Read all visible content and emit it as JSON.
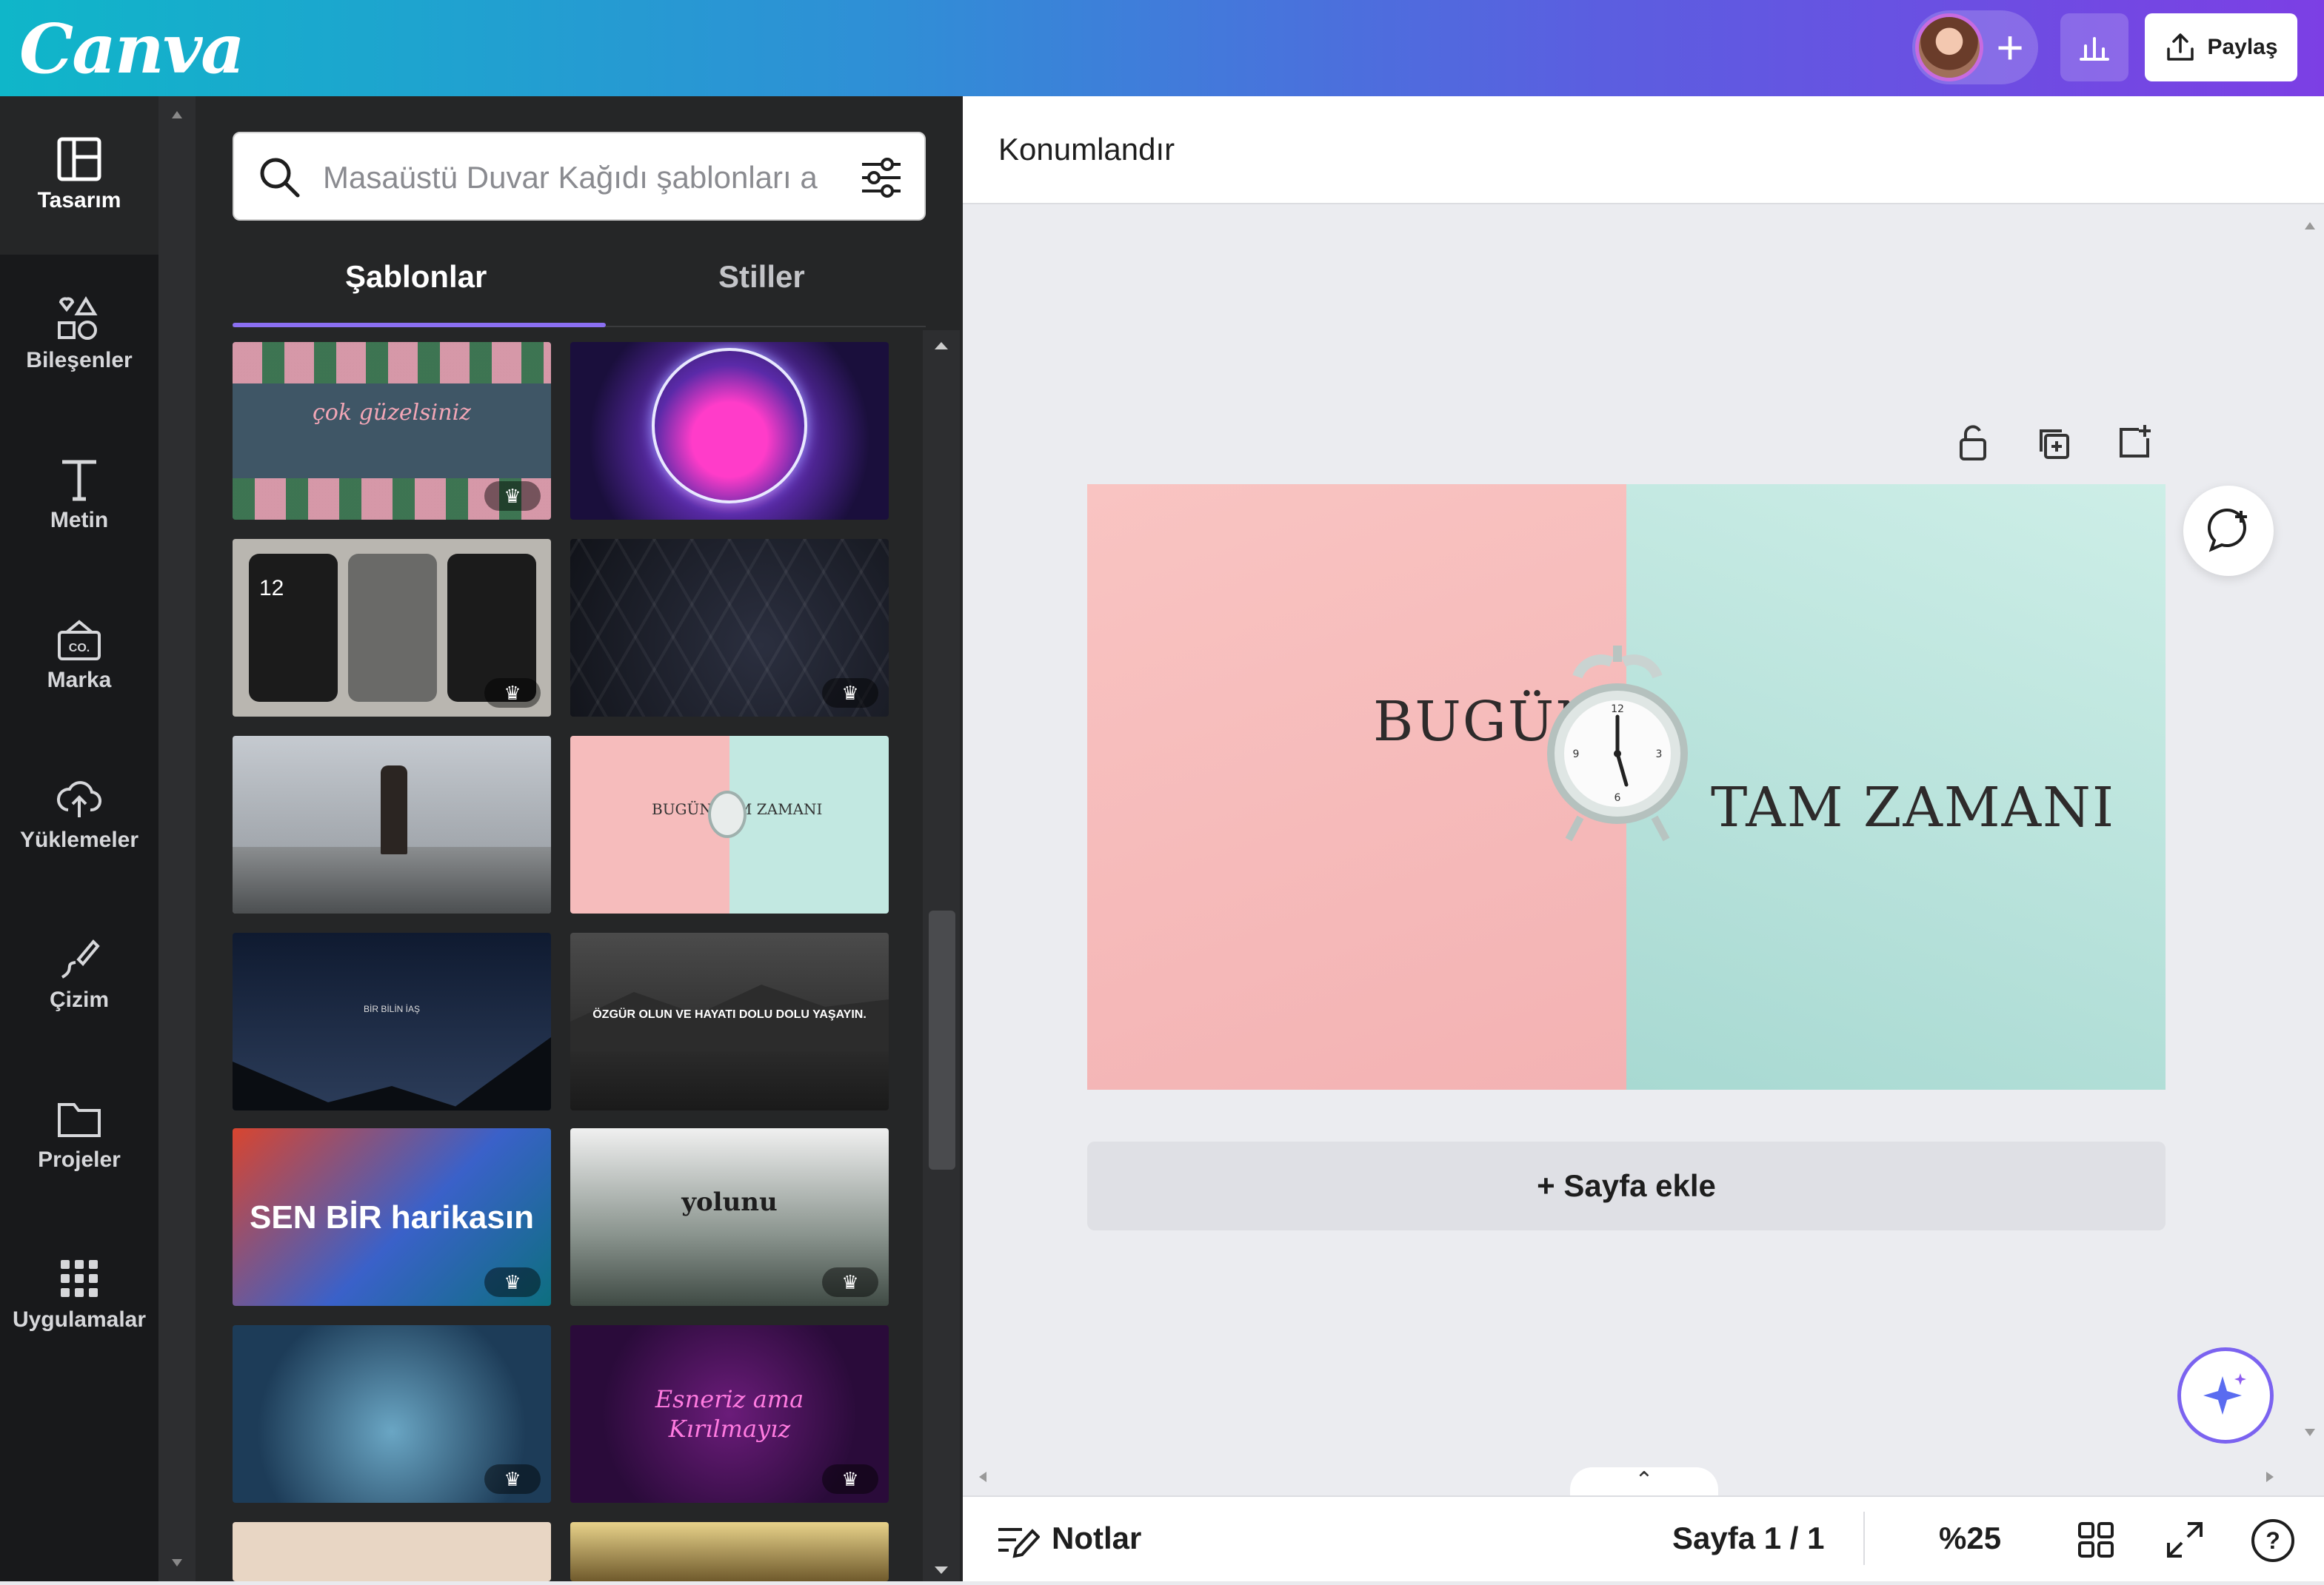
{
  "app": {
    "logo": "Canva"
  },
  "header": {
    "share_label": "Paylaş",
    "add_icon": "plus-icon",
    "analytics_icon": "analytics-icon",
    "share_icon": "upload-icon"
  },
  "sidebar": {
    "items": [
      {
        "label": "Tasarım",
        "icon": "layout-icon"
      },
      {
        "label": "Bileşenler",
        "icon": "shapes-icon"
      },
      {
        "label": "Metin",
        "icon": "text-icon"
      },
      {
        "label": "Marka",
        "icon": "brand-icon"
      },
      {
        "label": "Yüklemeler",
        "icon": "upload-cloud-icon"
      },
      {
        "label": "Çizim",
        "icon": "draw-icon"
      },
      {
        "label": "Projeler",
        "icon": "folder-icon"
      },
      {
        "label": "Uygulamalar",
        "icon": "apps-grid-icon"
      }
    ]
  },
  "panel": {
    "search_placeholder": "Masaüstü Duvar Kağıdı şablonları a",
    "tabs": [
      {
        "label": "Şablonlar",
        "active": true
      },
      {
        "label": "Stiller",
        "active": false
      }
    ],
    "templates": [
      {
        "text": "çok güzelsiniz",
        "premium": true
      },
      {
        "text": "",
        "premium": false
      },
      {
        "text": "12",
        "premium": true
      },
      {
        "text": "",
        "premium": true
      },
      {
        "text": "",
        "premium": false
      },
      {
        "text": "BUGÜN TAM ZAMANI",
        "premium": false
      },
      {
        "text": "BİR BİLİN İAŞ",
        "premium": false
      },
      {
        "text": "ÖZGÜR OLUN VE HAYATI DOLU DOLU YAŞAYIN.",
        "premium": false
      },
      {
        "text": "SEN BİR harikasın",
        "premium": true
      },
      {
        "text": "yolunu",
        "premium": true
      },
      {
        "text": "",
        "premium": true
      },
      {
        "text": "Esneriz ama Kırılmayız",
        "premium": true
      }
    ]
  },
  "toolbar": {
    "position_label": "Konumlandır"
  },
  "canvas": {
    "left_text": "BUGÜN",
    "right_text": "TAM ZAMANI",
    "left_color": "#f6bcbc",
    "right_color": "#bfe6df"
  },
  "add_page_label": "+ Sayfa ekle",
  "footer": {
    "notes_label": "Notlar",
    "page_label": "Sayfa 1 / 1",
    "zoom_label": "%25"
  }
}
